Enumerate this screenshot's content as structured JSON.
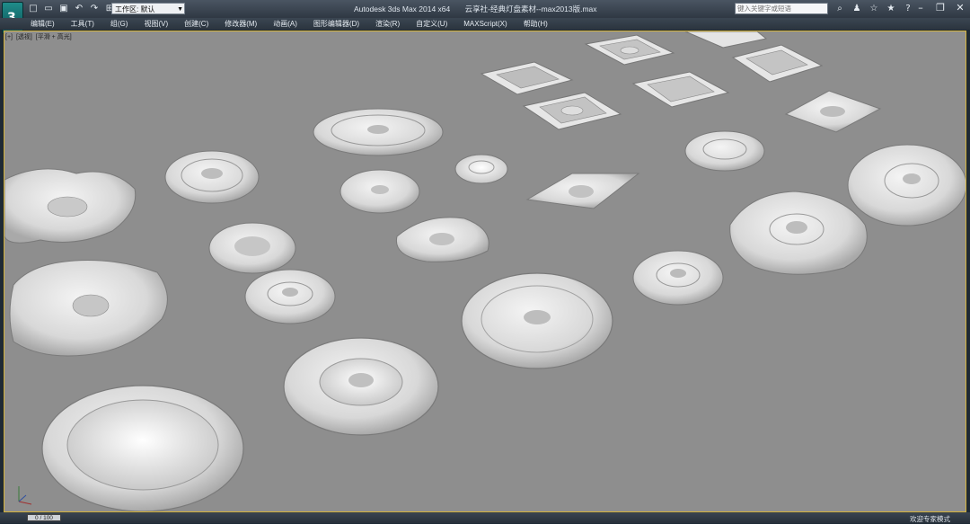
{
  "app": {
    "logo_letter": "3",
    "window_title": "Autodesk 3ds Max  2014 x64",
    "file_name": "云享社-经典灯盘素材--max2013版.max",
    "workspace": "工作区: 默认",
    "search_placeholder": "键入关键字或短语"
  },
  "quick_access": [
    "new-icon",
    "open-icon",
    "save-icon",
    "undo-icon",
    "redo-icon",
    "project-icon"
  ],
  "menu": {
    "items": [
      "编辑(E)",
      "工具(T)",
      "组(G)",
      "视图(V)",
      "创建(C)",
      "修改器(M)",
      "动画(A)",
      "图形编辑器(D)",
      "渲染(R)",
      "自定义(U)",
      "MAXScript(X)",
      "帮助(H)"
    ]
  },
  "viewport": {
    "label_parts": [
      "[+]",
      "[透视]",
      "[平滑 + 高光]"
    ]
  },
  "status": {
    "frame": "0 / 100",
    "mode": "欢迎专家模式"
  },
  "colors": {
    "viewport_bg": "#8e8e8e",
    "active_border": "#d4b23a",
    "object": "#e8e8e8"
  }
}
